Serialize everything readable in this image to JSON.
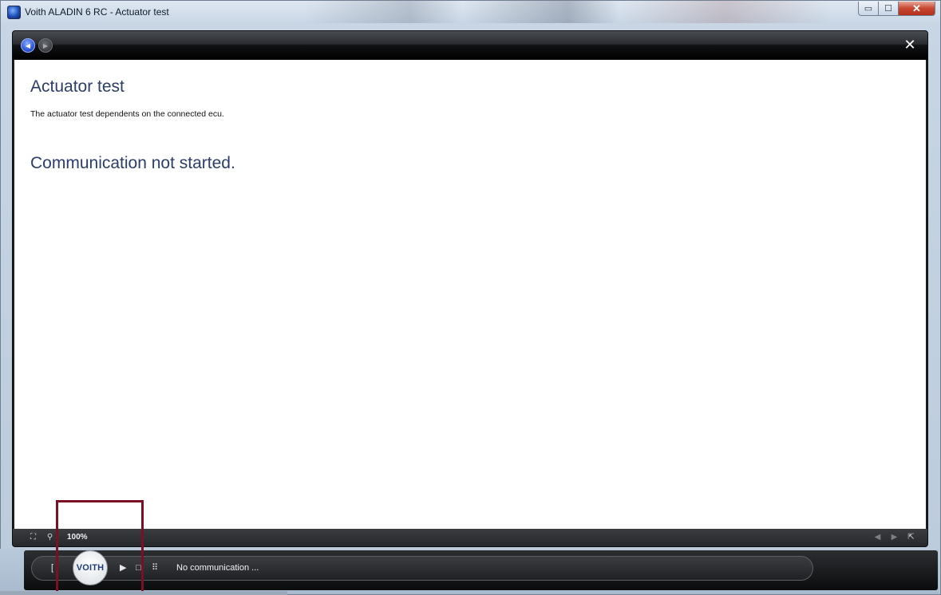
{
  "window": {
    "title": "Voith ALADIN 6 RC - Actuator test",
    "controls": {
      "minimize": "▭",
      "maximize": "☐",
      "close": "✕"
    }
  },
  "nav": {
    "back_icon": "back-arrow-icon",
    "forward_icon": "forward-arrow-icon",
    "back_glyph": "◀",
    "forward_glyph": "▶",
    "close_glyph": "✕"
  },
  "content": {
    "title": "Actuator test",
    "description": "The actuator test dependents on the connected ecu.",
    "status_message": "Communication not started."
  },
  "status_strip": {
    "fit_glyph": "⛶",
    "search_glyph": "⚲",
    "zoom": "100%",
    "prev_glyph": "◀",
    "next_glyph": "▶",
    "popout_glyph": "⇱"
  },
  "dock": {
    "bracket_glyph": "[ ]",
    "logo_text": "VOITH",
    "play_glyph": "▶",
    "stop_glyph": "□",
    "grid_glyph": "⠿",
    "communication_status": "No communication ..."
  },
  "colors": {
    "heading": "#2b3d6b",
    "highlight": "#7b0f24",
    "panel": "#1b1d20"
  }
}
